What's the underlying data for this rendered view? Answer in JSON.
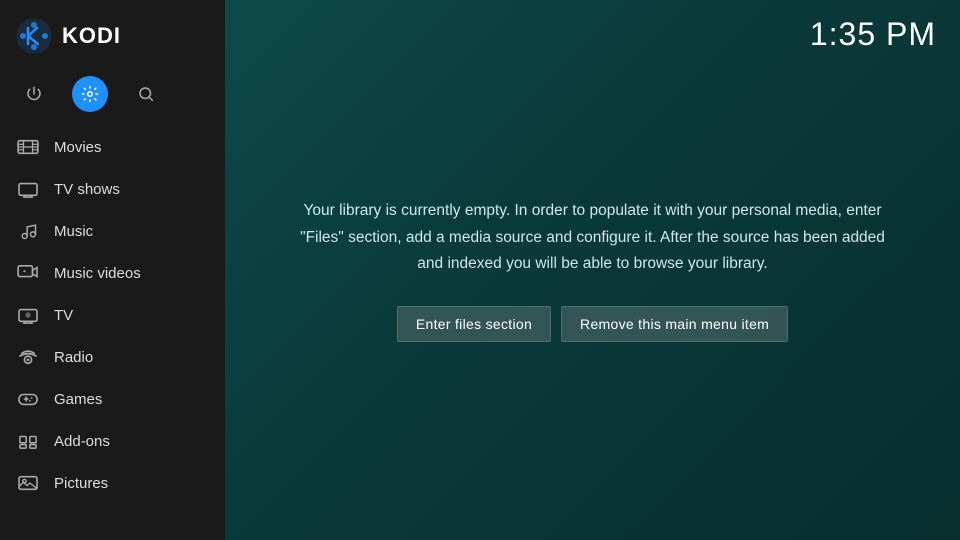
{
  "sidebar": {
    "logo_text": "KODI",
    "icons": [
      {
        "name": "power-icon",
        "symbol": "⏻",
        "active": false
      },
      {
        "name": "settings-icon",
        "symbol": "⚙",
        "active": true
      },
      {
        "name": "search-icon",
        "symbol": "🔍",
        "active": false
      }
    ],
    "nav_items": [
      {
        "name": "movies",
        "label": "Movies",
        "icon": "film"
      },
      {
        "name": "tv-shows",
        "label": "TV shows",
        "icon": "tv"
      },
      {
        "name": "music",
        "label": "Music",
        "icon": "music"
      },
      {
        "name": "music-videos",
        "label": "Music videos",
        "icon": "music-video"
      },
      {
        "name": "tv",
        "label": "TV",
        "icon": "tv2"
      },
      {
        "name": "radio",
        "label": "Radio",
        "icon": "radio"
      },
      {
        "name": "games",
        "label": "Games",
        "icon": "games"
      },
      {
        "name": "add-ons",
        "label": "Add-ons",
        "icon": "addons"
      },
      {
        "name": "pictures",
        "label": "Pictures",
        "icon": "pictures"
      }
    ]
  },
  "header": {
    "clock": "1:35 PM"
  },
  "main": {
    "library_message": "Your library is currently empty. In order to populate it with your personal media, enter \"Files\" section, add a media source and configure it. After the source has been added and indexed you will be able to browse your library.",
    "btn_enter_files": "Enter files section",
    "btn_remove_item": "Remove this main menu item"
  }
}
